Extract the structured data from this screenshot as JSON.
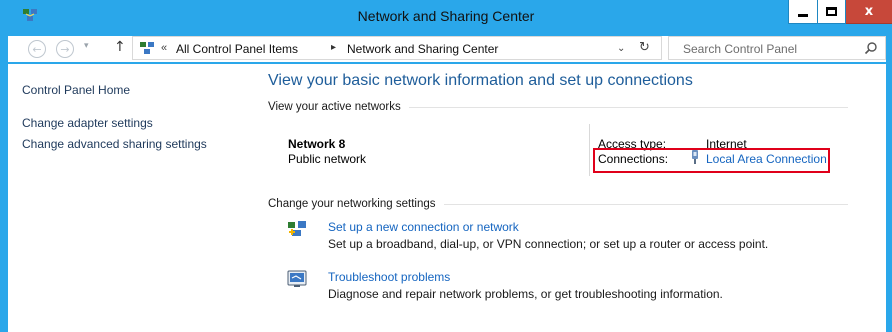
{
  "window": {
    "title": "Network and Sharing Center",
    "close_glyph": "x"
  },
  "address_bar": {
    "breadcrumb_prefix": "«",
    "crumbs": [
      "All Control Panel Items",
      "Network and Sharing Center"
    ],
    "separator": "▸"
  },
  "search": {
    "placeholder": "Search Control Panel"
  },
  "sidebar": {
    "items": [
      {
        "label": "Control Panel Home"
      },
      {
        "label": "Change adapter settings"
      },
      {
        "label": "Change advanced sharing settings"
      }
    ]
  },
  "main": {
    "title": "View your basic network information and set up connections",
    "active_networks_heading": "View your active networks",
    "network": {
      "name": "Network  8",
      "category": "Public network",
      "access_type_label": "Access type:",
      "access_type_value": "Internet",
      "connections_label": "Connections:",
      "connection_name": "Local Area Connection"
    },
    "settings_heading": "Change your networking settings",
    "tasks": [
      {
        "link": "Set up a new connection or network",
        "description": "Set up a broadband, dial-up, or VPN connection; or set up a router or access point."
      },
      {
        "link": "Troubleshoot problems",
        "description": "Diagnose and repair network problems, or get troubleshooting information."
      }
    ]
  },
  "colors": {
    "title_bar": "#2aa7ea",
    "close_button": "#c7483a",
    "link": "#1565c0",
    "heading": "#1e5d9a",
    "highlight_box": "#e0001a"
  }
}
